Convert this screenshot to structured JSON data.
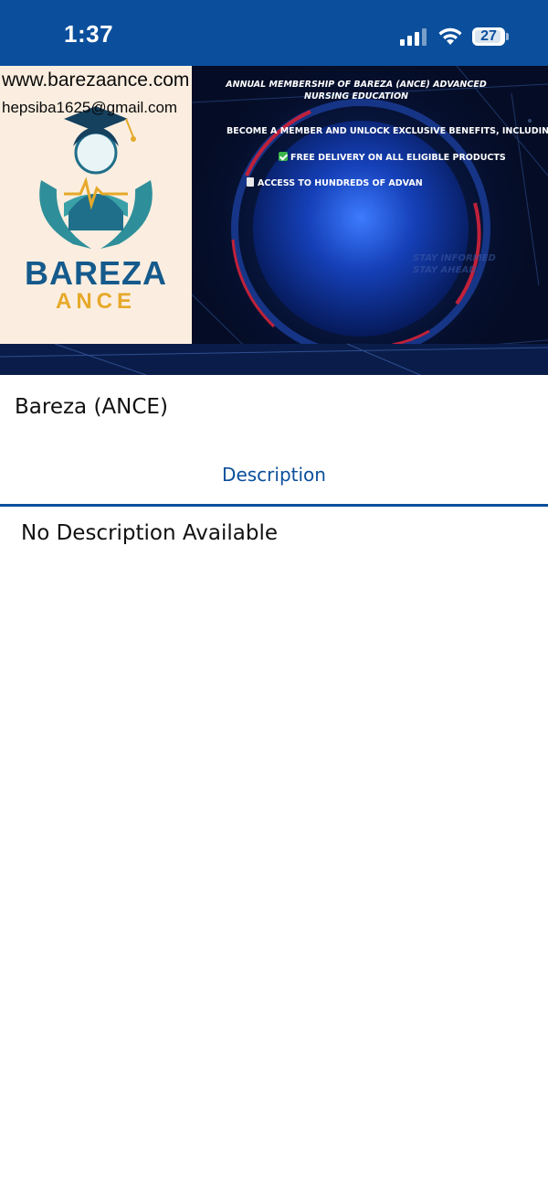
{
  "status_bar": {
    "time": "1:37",
    "battery": "27",
    "background": "#0b4f9c"
  },
  "banner": {
    "logo_panel": {
      "url": "www.barezaance.com",
      "email": "hepsiba1625@gmail.com",
      "brand_name": "BAREZA",
      "brand_sub": "ANCE"
    },
    "promo": {
      "title": "ANNUAL MEMBERSHIP OF BAREZA (ANCE) ADVANCED NURSING EDUCATION",
      "line1": "BECOME A MEMBER AND UNLOCK EXCLUSIVE BENEFITS, INCLUDING:",
      "line2": "FREE DELIVERY ON ALL ELIGIBLE PRODUCTS",
      "line3": "ACCESS TO HUNDREDS OF ADVAN",
      "faded_line1": "STAY INFORMED",
      "faded_line2": "STAY AHEAD"
    }
  },
  "product": {
    "title": "Bareza (ANCE)"
  },
  "tabs": [
    {
      "label": "Description",
      "active": true
    }
  ],
  "description": {
    "text": "No Description Available"
  },
  "colors": {
    "accent": "#0b4f9c",
    "brand_blue": "#155a8c",
    "brand_gold": "#e6a92a",
    "logo_bg": "#fbeee0"
  }
}
